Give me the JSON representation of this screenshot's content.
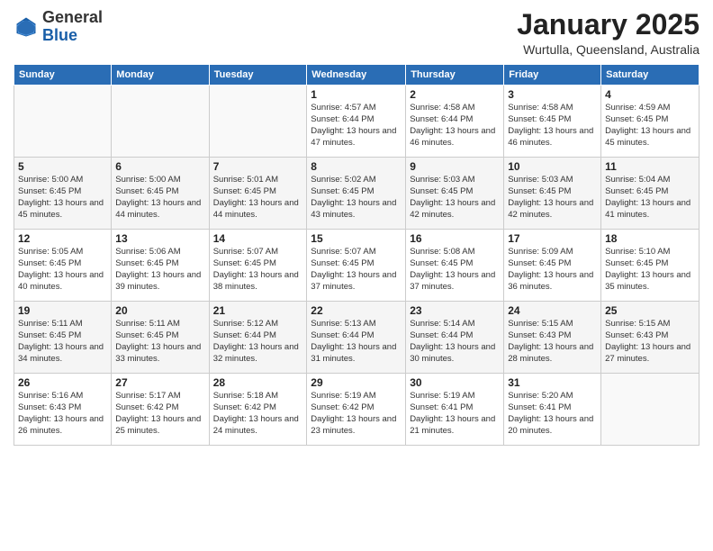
{
  "header": {
    "logo_general": "General",
    "logo_blue": "Blue",
    "month": "January 2025",
    "location": "Wurtulla, Queensland, Australia"
  },
  "weekdays": [
    "Sunday",
    "Monday",
    "Tuesday",
    "Wednesday",
    "Thursday",
    "Friday",
    "Saturday"
  ],
  "weeks": [
    [
      {
        "day": "",
        "info": ""
      },
      {
        "day": "",
        "info": ""
      },
      {
        "day": "",
        "info": ""
      },
      {
        "day": "1",
        "info": "Sunrise: 4:57 AM\nSunset: 6:44 PM\nDaylight: 13 hours and 47 minutes."
      },
      {
        "day": "2",
        "info": "Sunrise: 4:58 AM\nSunset: 6:44 PM\nDaylight: 13 hours and 46 minutes."
      },
      {
        "day": "3",
        "info": "Sunrise: 4:58 AM\nSunset: 6:45 PM\nDaylight: 13 hours and 46 minutes."
      },
      {
        "day": "4",
        "info": "Sunrise: 4:59 AM\nSunset: 6:45 PM\nDaylight: 13 hours and 45 minutes."
      }
    ],
    [
      {
        "day": "5",
        "info": "Sunrise: 5:00 AM\nSunset: 6:45 PM\nDaylight: 13 hours and 45 minutes."
      },
      {
        "day": "6",
        "info": "Sunrise: 5:00 AM\nSunset: 6:45 PM\nDaylight: 13 hours and 44 minutes."
      },
      {
        "day": "7",
        "info": "Sunrise: 5:01 AM\nSunset: 6:45 PM\nDaylight: 13 hours and 44 minutes."
      },
      {
        "day": "8",
        "info": "Sunrise: 5:02 AM\nSunset: 6:45 PM\nDaylight: 13 hours and 43 minutes."
      },
      {
        "day": "9",
        "info": "Sunrise: 5:03 AM\nSunset: 6:45 PM\nDaylight: 13 hours and 42 minutes."
      },
      {
        "day": "10",
        "info": "Sunrise: 5:03 AM\nSunset: 6:45 PM\nDaylight: 13 hours and 42 minutes."
      },
      {
        "day": "11",
        "info": "Sunrise: 5:04 AM\nSunset: 6:45 PM\nDaylight: 13 hours and 41 minutes."
      }
    ],
    [
      {
        "day": "12",
        "info": "Sunrise: 5:05 AM\nSunset: 6:45 PM\nDaylight: 13 hours and 40 minutes."
      },
      {
        "day": "13",
        "info": "Sunrise: 5:06 AM\nSunset: 6:45 PM\nDaylight: 13 hours and 39 minutes."
      },
      {
        "day": "14",
        "info": "Sunrise: 5:07 AM\nSunset: 6:45 PM\nDaylight: 13 hours and 38 minutes."
      },
      {
        "day": "15",
        "info": "Sunrise: 5:07 AM\nSunset: 6:45 PM\nDaylight: 13 hours and 37 minutes."
      },
      {
        "day": "16",
        "info": "Sunrise: 5:08 AM\nSunset: 6:45 PM\nDaylight: 13 hours and 37 minutes."
      },
      {
        "day": "17",
        "info": "Sunrise: 5:09 AM\nSunset: 6:45 PM\nDaylight: 13 hours and 36 minutes."
      },
      {
        "day": "18",
        "info": "Sunrise: 5:10 AM\nSunset: 6:45 PM\nDaylight: 13 hours and 35 minutes."
      }
    ],
    [
      {
        "day": "19",
        "info": "Sunrise: 5:11 AM\nSunset: 6:45 PM\nDaylight: 13 hours and 34 minutes."
      },
      {
        "day": "20",
        "info": "Sunrise: 5:11 AM\nSunset: 6:45 PM\nDaylight: 13 hours and 33 minutes."
      },
      {
        "day": "21",
        "info": "Sunrise: 5:12 AM\nSunset: 6:44 PM\nDaylight: 13 hours and 32 minutes."
      },
      {
        "day": "22",
        "info": "Sunrise: 5:13 AM\nSunset: 6:44 PM\nDaylight: 13 hours and 31 minutes."
      },
      {
        "day": "23",
        "info": "Sunrise: 5:14 AM\nSunset: 6:44 PM\nDaylight: 13 hours and 30 minutes."
      },
      {
        "day": "24",
        "info": "Sunrise: 5:15 AM\nSunset: 6:43 PM\nDaylight: 13 hours and 28 minutes."
      },
      {
        "day": "25",
        "info": "Sunrise: 5:15 AM\nSunset: 6:43 PM\nDaylight: 13 hours and 27 minutes."
      }
    ],
    [
      {
        "day": "26",
        "info": "Sunrise: 5:16 AM\nSunset: 6:43 PM\nDaylight: 13 hours and 26 minutes."
      },
      {
        "day": "27",
        "info": "Sunrise: 5:17 AM\nSunset: 6:42 PM\nDaylight: 13 hours and 25 minutes."
      },
      {
        "day": "28",
        "info": "Sunrise: 5:18 AM\nSunset: 6:42 PM\nDaylight: 13 hours and 24 minutes."
      },
      {
        "day": "29",
        "info": "Sunrise: 5:19 AM\nSunset: 6:42 PM\nDaylight: 13 hours and 23 minutes."
      },
      {
        "day": "30",
        "info": "Sunrise: 5:19 AM\nSunset: 6:41 PM\nDaylight: 13 hours and 21 minutes."
      },
      {
        "day": "31",
        "info": "Sunrise: 5:20 AM\nSunset: 6:41 PM\nDaylight: 13 hours and 20 minutes."
      },
      {
        "day": "",
        "info": ""
      }
    ]
  ]
}
